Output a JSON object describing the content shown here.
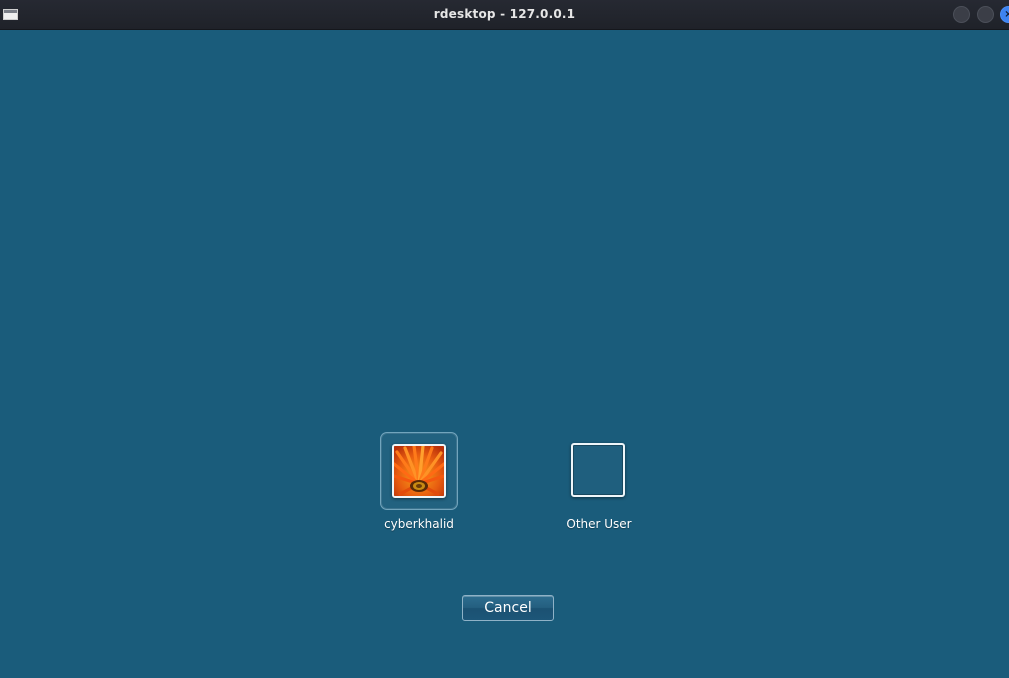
{
  "window": {
    "title": "rdesktop - 127.0.0.1",
    "icon": "window-app-icon",
    "controls": {
      "minimize_icon": "minimize-circle-icon",
      "maximize_icon": "maximize-circle-icon",
      "close_icon": "close-circle-icon",
      "close_glyph": "×"
    }
  },
  "login_screen": {
    "users": [
      {
        "name": "cyberkhalid",
        "avatar": "orange-flower-picture",
        "selected": true
      },
      {
        "name": "Other User",
        "avatar": "blank",
        "selected": false
      }
    ],
    "cancel_label": "Cancel"
  },
  "colors": {
    "background": "#1a5c7b",
    "titlebar": "#262932",
    "close_button": "#3d83f1"
  }
}
